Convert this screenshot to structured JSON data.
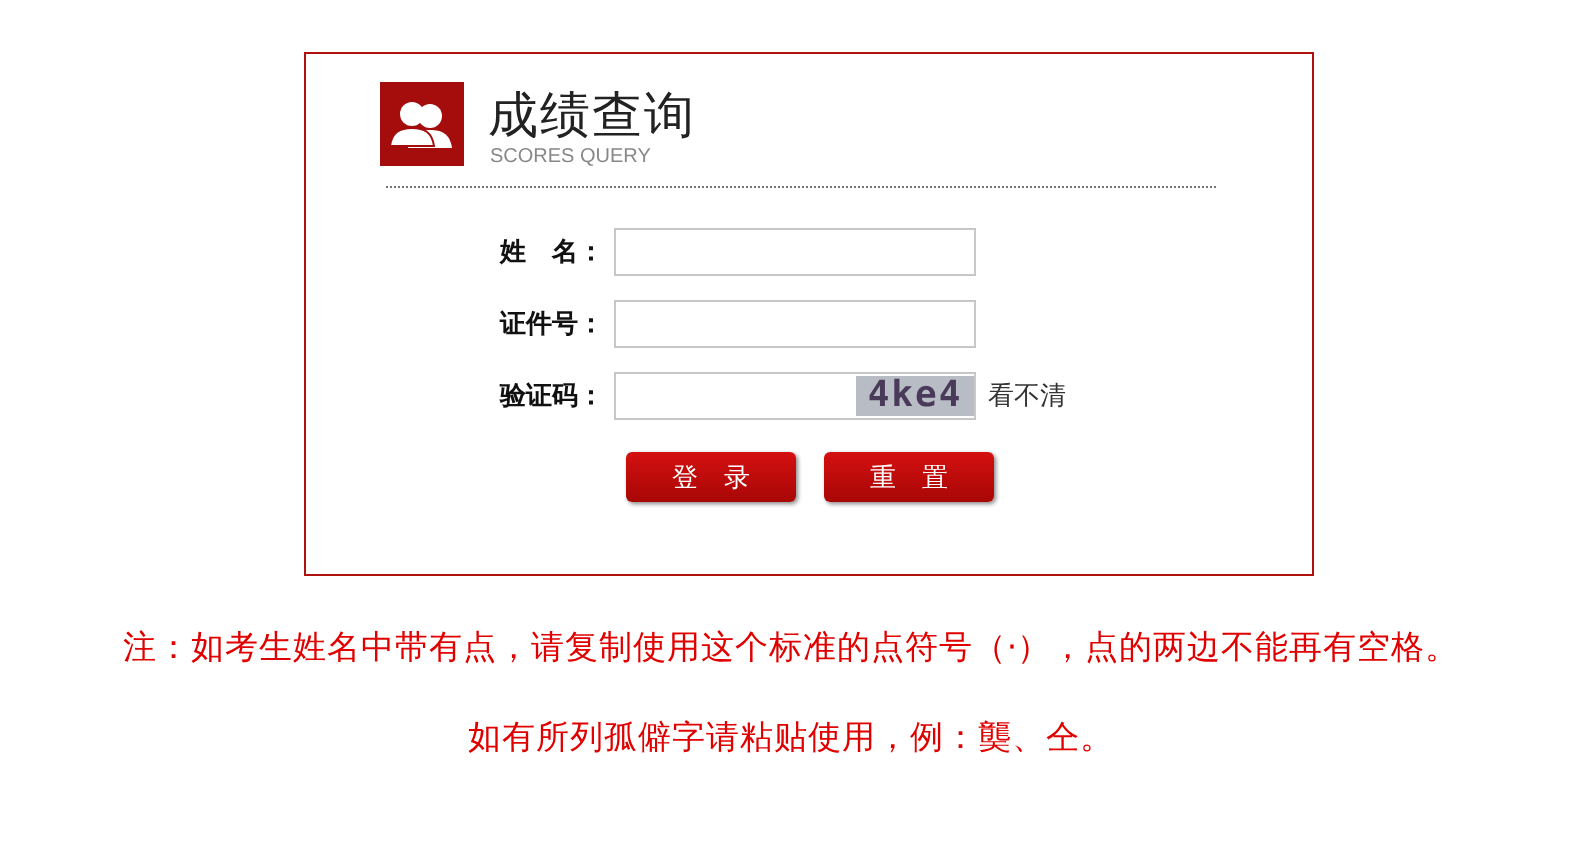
{
  "header": {
    "title": "成绩查询",
    "subtitle": "SCORES QUERY"
  },
  "fields": [
    {
      "kind": "text",
      "label": "姓　名："
    },
    {
      "kind": "text",
      "label": "证件号："
    },
    {
      "kind": "captcha",
      "label": "验证码：",
      "captcha": "4ke4",
      "refresh": "看不清"
    }
  ],
  "buttons": [
    "登　录",
    "重　置"
  ],
  "notes": [
    "注：如考生姓名中带有点，请复制使用这个标准的点符号（·），点的两边不能再有空格。",
    "如有所列孤僻字请粘贴使用，例：龑、仝。"
  ]
}
